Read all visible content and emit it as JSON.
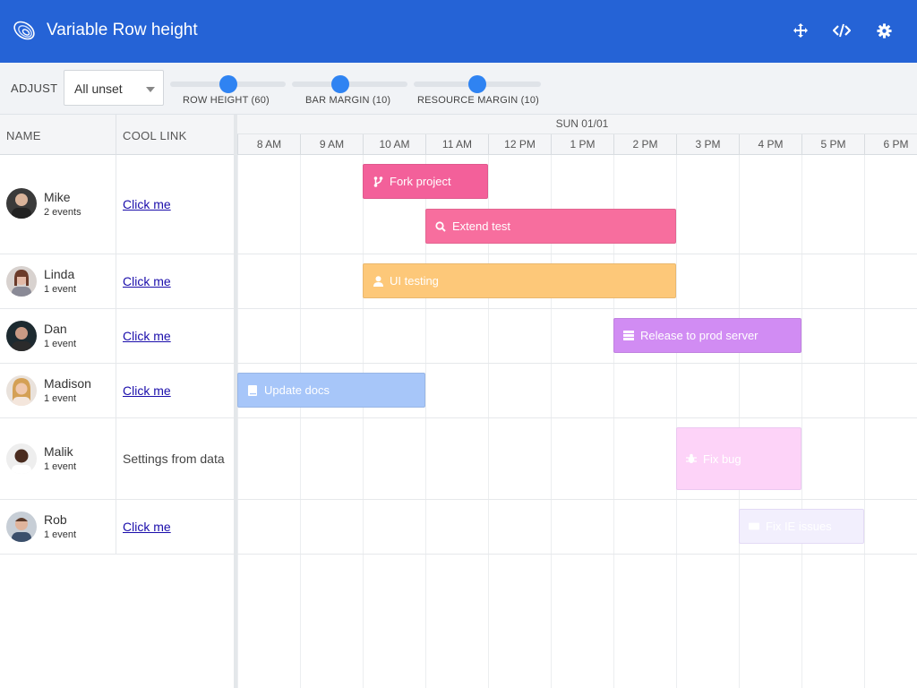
{
  "header": {
    "title": "Variable Row height"
  },
  "toolbar": {
    "adjust_label": "ADJUST",
    "combo_value": "All unset",
    "sliders": [
      {
        "label": "ROW HEIGHT (60)",
        "value_pct": 50
      },
      {
        "label": "BAR MARGIN (10)",
        "value_pct": 42
      },
      {
        "label": "RESOURCE MARGIN (10)",
        "value_pct": 50
      }
    ]
  },
  "grid": {
    "columns": {
      "name": "NAME",
      "link": "COOL LINK"
    },
    "resources": [
      {
        "name": "Mike",
        "count": "2 events",
        "link": "Click me"
      },
      {
        "name": "Linda",
        "count": "1 event",
        "link": "Click me"
      },
      {
        "name": "Dan",
        "count": "1 event",
        "link": "Click me"
      },
      {
        "name": "Madison",
        "count": "1 event",
        "link": "Click me"
      },
      {
        "name": "Malik",
        "count": "1 event",
        "link": "Settings from data"
      },
      {
        "name": "Rob",
        "count": "1 event",
        "link": "Click me"
      }
    ]
  },
  "timeline": {
    "day": "SUN 01/01",
    "hours": [
      "8 AM",
      "9 AM",
      "10 AM",
      "11 AM",
      "12 PM",
      "1 PM",
      "2 PM",
      "3 PM",
      "4 PM",
      "5 PM",
      "6 PM"
    ]
  },
  "events": [
    {
      "name": "Fork project",
      "resource": "Mike",
      "start": "10 AM",
      "end": "12 PM",
      "icon": "code-fork-icon",
      "color": "#f3609a"
    },
    {
      "name": "Extend test",
      "resource": "Mike",
      "start": "11 AM",
      "end": "3 PM",
      "icon": "search-icon",
      "color": "#f76e9e"
    },
    {
      "name": "UI testing",
      "resource": "Linda",
      "start": "10 AM",
      "end": "3 PM",
      "icon": "user-icon",
      "color": "#fdc879"
    },
    {
      "name": "Release to prod server",
      "resource": "Dan",
      "start": "2 PM",
      "end": "5 PM",
      "icon": "server-icon",
      "color": "#d18cf3"
    },
    {
      "name": "Update docs",
      "resource": "Madison",
      "start": "8 AM",
      "end": "11 AM",
      "icon": "book-icon",
      "color": "#a7c6f9"
    },
    {
      "name": "Fix bug",
      "resource": "Malik",
      "start": "3 PM",
      "end": "5 PM",
      "icon": "bug-icon",
      "color": "#fdd3f8"
    },
    {
      "name": "Fix IE issues",
      "resource": "Rob",
      "start": "4 PM",
      "end": "6 PM",
      "icon": "keyboard-icon",
      "color": "#f2effd"
    }
  ]
}
